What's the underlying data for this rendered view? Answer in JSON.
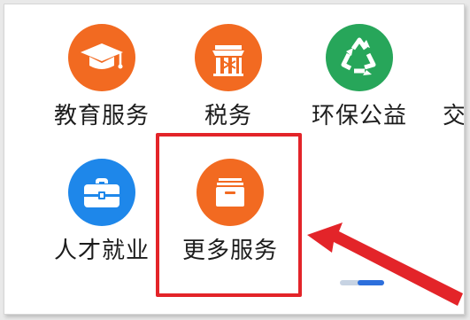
{
  "services": {
    "row1": [
      {
        "label": "教育服务",
        "icon": "graduation-cap-icon",
        "color": "#f26a21"
      },
      {
        "label": "税务",
        "icon": "tax-emblem-icon",
        "color": "#f26a21"
      },
      {
        "label": "环保公益",
        "icon": "recycle-icon",
        "color": "#27a65a"
      },
      {
        "label": "交",
        "icon": "partial-item",
        "color": "#1c1c1c"
      }
    ],
    "row2": [
      {
        "label": "人才就业",
        "icon": "briefcase-icon",
        "color": "#1e87ea"
      },
      {
        "label": "更多服务",
        "icon": "archive-box-icon",
        "color": "#f26a21"
      }
    ]
  },
  "annotation": {
    "box_color": "#e32429",
    "arrow_color": "#e32429"
  },
  "scroll_indicator": {
    "track_color": "#c7d3e3",
    "thumb_color": "#2d6fdc"
  }
}
